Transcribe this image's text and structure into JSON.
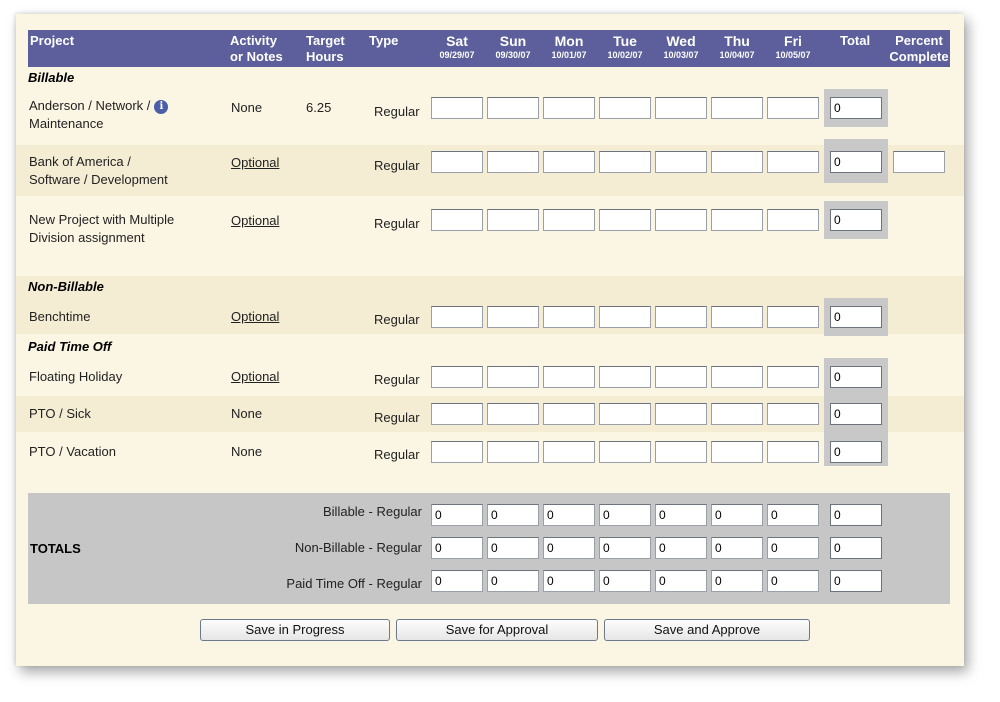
{
  "header": {
    "project": "Project",
    "activity_1": "Activity",
    "activity_2": "or Notes",
    "target_1": "Target",
    "target_2": "Hours",
    "type": "Type",
    "days": [
      {
        "name": "Sat",
        "date": "09/29/07"
      },
      {
        "name": "Sun",
        "date": "09/30/07"
      },
      {
        "name": "Mon",
        "date": "10/01/07"
      },
      {
        "name": "Tue",
        "date": "10/02/07"
      },
      {
        "name": "Wed",
        "date": "10/03/07"
      },
      {
        "name": "Thu",
        "date": "10/04/07"
      },
      {
        "name": "Fri",
        "date": "10/05/07"
      }
    ],
    "total": "Total",
    "percent_1": "Percent",
    "percent_2": "Complete"
  },
  "sections": {
    "billable": "Billable",
    "non_billable": "Non-Billable",
    "pto": "Paid Time Off"
  },
  "rows": [
    {
      "project_1": "Anderson / Network /",
      "project_2": "Maintenance",
      "activity": "None",
      "target": "6.25",
      "type": "Regular",
      "total": "0",
      "info_icon": "info-icon"
    },
    {
      "project_1": "Bank of America /",
      "project_2": "Software / Development",
      "activity": "Optional",
      "target": "",
      "type": "Regular",
      "total": "0",
      "percent": ""
    },
    {
      "project_1": "New Project with Multiple",
      "project_2": "Division assignment",
      "activity": "Optional",
      "target": "",
      "type": "Regular",
      "total": "0"
    },
    {
      "project_1": "Benchtime",
      "activity": "Optional",
      "type": "Regular",
      "total": "0"
    },
    {
      "project_1": "Floating Holiday",
      "activity": "Optional",
      "type": "Regular",
      "total": "0"
    },
    {
      "project_1": "PTO / Sick",
      "activity": "None",
      "type": "Regular",
      "total": "0"
    },
    {
      "project_1": "PTO / Vacation",
      "activity": "None",
      "type": "Regular",
      "total": "0"
    }
  ],
  "totals": {
    "label": "TOTALS",
    "rows": [
      {
        "label": "Billable - Regular",
        "values": [
          "0",
          "0",
          "0",
          "0",
          "0",
          "0",
          "0"
        ],
        "total": "0"
      },
      {
        "label": "Non-Billable - Regular",
        "values": [
          "0",
          "0",
          "0",
          "0",
          "0",
          "0",
          "0"
        ],
        "total": "0"
      },
      {
        "label": "Paid Time Off - Regular",
        "values": [
          "0",
          "0",
          "0",
          "0",
          "0",
          "0",
          "0"
        ],
        "total": "0"
      }
    ]
  },
  "buttons": {
    "save_progress": "Save in Progress",
    "save_approval": "Save for Approval",
    "save_approve": "Save and Approve"
  },
  "colors": {
    "header_bg": "#5c5f9b",
    "panel_bg": "#fbf6e3",
    "band_bg": "#f4edd4",
    "totals_bg": "#c6c6c6"
  }
}
